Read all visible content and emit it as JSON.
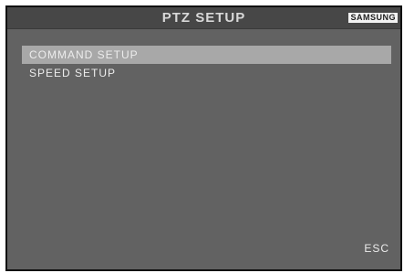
{
  "header": {
    "title": "PTZ SETUP",
    "brand": "SAMSUNG"
  },
  "menu": {
    "items": [
      {
        "label": "COMMAND SETUP",
        "selected": true
      },
      {
        "label": "SPEED SETUP",
        "selected": false
      }
    ]
  },
  "footer": {
    "esc_label": "ESC"
  },
  "colors": {
    "screen_bg": "#626262",
    "header_bg": "#474747",
    "highlight": "#a8a8a8",
    "text": "#ececec"
  }
}
